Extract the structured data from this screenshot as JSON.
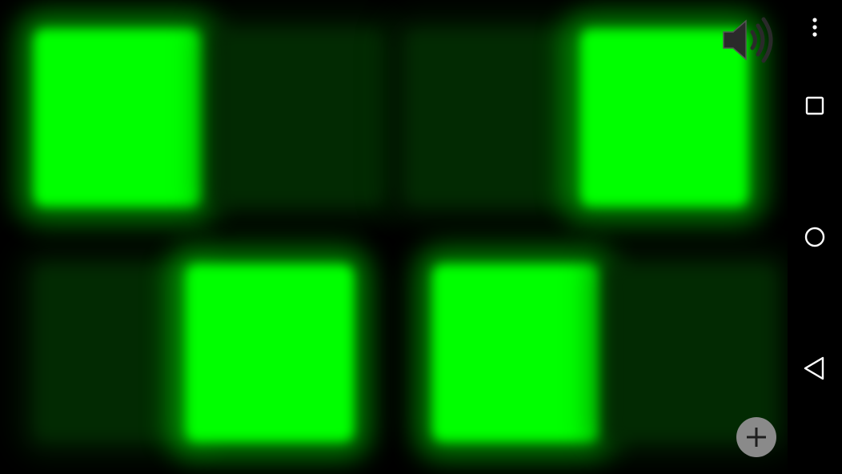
{
  "game": {
    "pads": [
      {
        "id": "top-1",
        "lit": true
      },
      {
        "id": "top-2",
        "lit": false
      },
      {
        "id": "top-3",
        "lit": false
      },
      {
        "id": "top-4",
        "lit": true
      },
      {
        "id": "bottom-1",
        "lit": false
      },
      {
        "id": "bottom-2",
        "lit": true
      },
      {
        "id": "bottom-3",
        "lit": true
      },
      {
        "id": "bottom-4",
        "lit": false
      }
    ],
    "lit_color": "#00ff00",
    "unlit_color": "#022a02",
    "sound": "on"
  },
  "controls": {
    "sound_icon": "speaker-volume-icon",
    "add_icon": "plus-icon",
    "add_button_color": "#8a8a8a"
  },
  "navbar": {
    "items": [
      "more-options-icon",
      "recents-square-icon",
      "home-circle-icon",
      "back-triangle-icon"
    ]
  }
}
